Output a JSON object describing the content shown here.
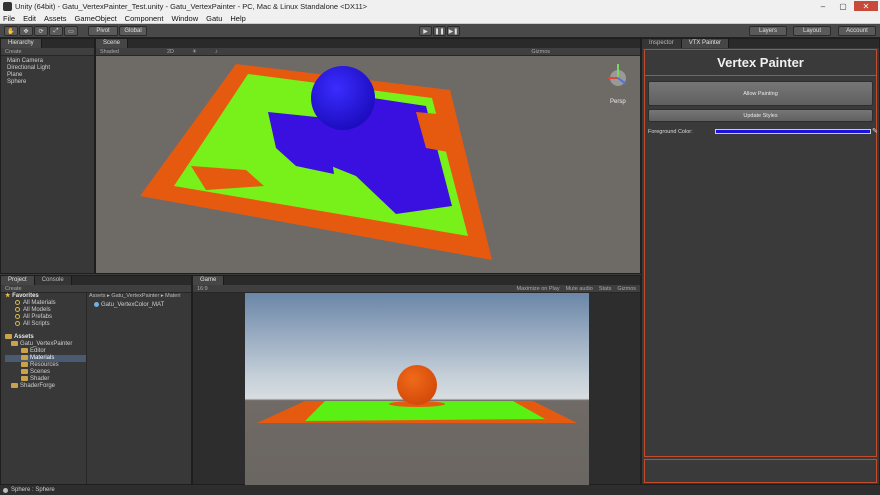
{
  "window": {
    "title": "Unity (64bit) - Gatu_VertexPainter_Test.unity - Gatu_VertexPainter - PC, Mac & Linux Standalone <DX11>"
  },
  "menu": [
    "File",
    "Edit",
    "Assets",
    "GameObject",
    "Component",
    "Window",
    "Gatu",
    "Help"
  ],
  "toolbar": {
    "pivot": "Pivot",
    "global": "Global",
    "layers": "Layers",
    "layout": "Layout",
    "account": "Account"
  },
  "hierarchy": {
    "tab": "Hierarchy",
    "create": "Create",
    "items": [
      "Main Camera",
      "Directional Light",
      "Plane",
      "Sphere"
    ]
  },
  "scene": {
    "tab": "Scene",
    "shading": "Shaded",
    "mode": "2D",
    "gizmos": "Gizmos",
    "persp": "Persp"
  },
  "project": {
    "tabs": [
      "Project",
      "Console"
    ],
    "create": "Create",
    "breadcrumb": "Assets ▸ Gatu_VertexPainter ▸ Materi",
    "favorites": "Favorites",
    "fav_items": [
      "All Materials",
      "All Models",
      "All Prefabs",
      "All Scripts"
    ],
    "assets": "Assets",
    "tree": [
      "Gatu_VertexPainter",
      "Editor",
      "Materials",
      "Resources",
      "Scenes",
      "Shader",
      "ShaderForge"
    ],
    "file": "Gatu_VertexColor_MAT"
  },
  "game": {
    "tab": "Game",
    "aspect": "16:9",
    "options": [
      "Maximize on Play",
      "Mute audio",
      "Stats",
      "Gizmos"
    ]
  },
  "inspector": {
    "tabs": [
      "Inspector",
      "VTX Painter"
    ],
    "title": "Vertex Painter",
    "allow": "Allow Painting",
    "update": "Update Styles",
    "fg_label": "Foreground Color:",
    "fg_color": "#1a12e0"
  },
  "status": {
    "text": "Sphere : Sphere"
  }
}
